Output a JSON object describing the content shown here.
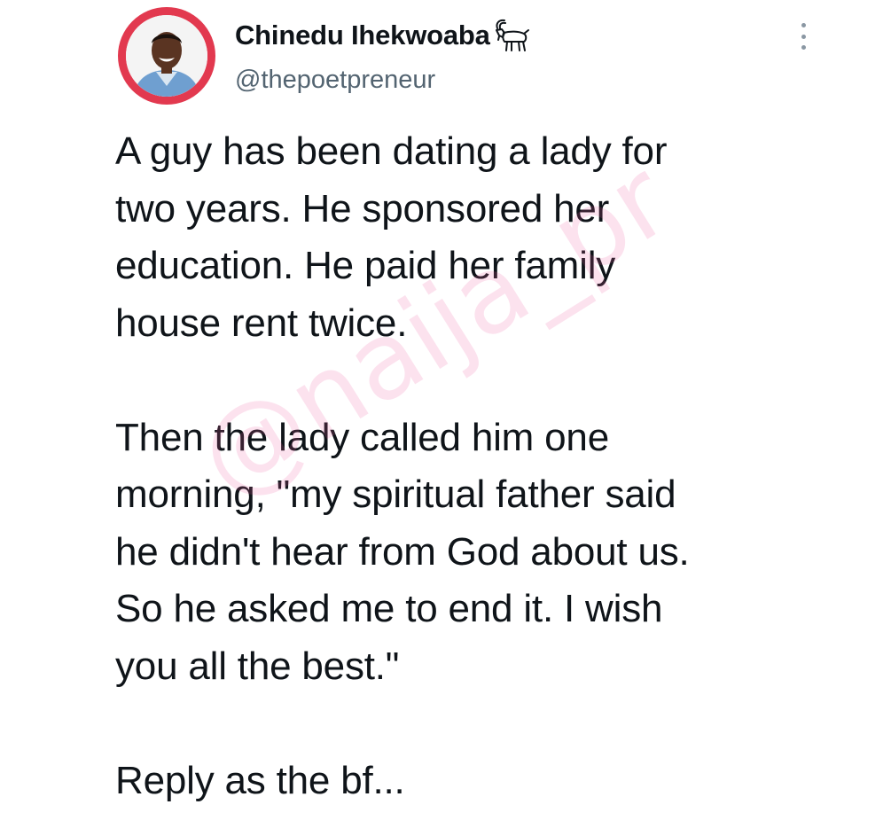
{
  "tweet": {
    "author": {
      "display_name": "Chinedu Ihekwoaba",
      "handle": "@thepoetpreneur",
      "badge_icon": "goat-icon",
      "avatar_ring_color": "#e2394f"
    },
    "more_icon": "more-options-icon",
    "text": "A guy has been dating a lady for\ntwo years. He sponsored her\neducation. He paid her family\nhouse rent twice.\n\nThen the lady called him one\nmorning, \"my spiritual father said\nhe didn't hear from God about us.\nSo he asked me to end it. I wish\nyou all the best.\"\n\nReply as the bf...",
    "watermark": "@naija_pr"
  }
}
